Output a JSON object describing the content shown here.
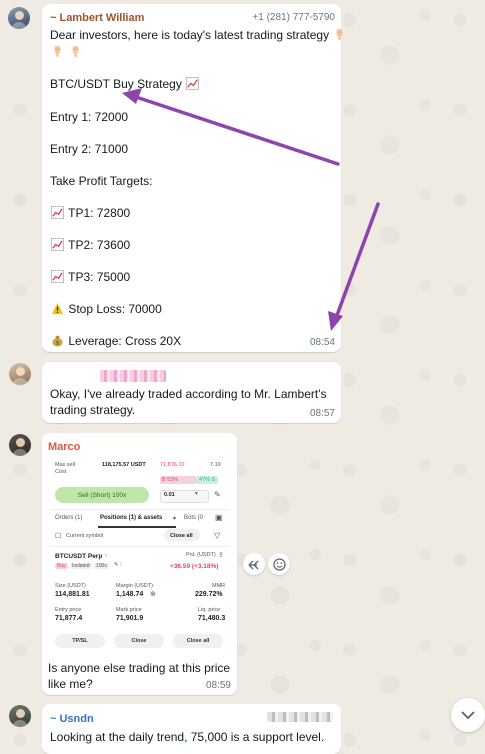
{
  "colors": {
    "chat_background": "#efeae2",
    "bubble": "#ffffff",
    "lambert_name": "#a0522d",
    "marco_name": "#e5533d",
    "usndn_name": "#3772c5",
    "annotation_arrow": "#8e44ad"
  },
  "messages": [
    {
      "sender": "~ Lambert William",
      "phone": "+1 (281) 777-5790",
      "lines": [
        "Dear investors, here is today's latest trading strategy",
        "BTC/USDT Buy Strategy",
        "Entry 1: 72000",
        "Entry 2: 71000",
        "Take Profit Targets:",
        "TP1: 72800",
        "TP2: 73600",
        "TP3: 75000",
        "Stop Loss: 70000",
        "Leverage: Cross 20X"
      ],
      "icons": [
        "pointing-down-hand-icon",
        "chart-increasing-icon",
        "warning-icon",
        "money-bag-icon"
      ],
      "time": "08:54"
    },
    {
      "sender": "",
      "lines": [
        "Okay, I've already traded according to Mr. Lambert's",
        "trading strategy."
      ],
      "time": "08:57"
    },
    {
      "sender": "Marco",
      "screenshot": {
        "max_sell_label": "Max sell",
        "cost_label": "Cost",
        "max_sell_value": "118,175.57 USDT",
        "price": "71,876.10",
        "qty": "7.19",
        "buy_pct": "B 53%",
        "sell_pct": "47% S",
        "sell_button": "Sell (Short) 100x",
        "qty_value": "0.01",
        "tabs": [
          "Orders (1)",
          "Positions (1) & assets",
          "Bots (0"
        ],
        "current_symbol": "Current symbol",
        "close_all_small": "Close all",
        "symbol": "BTCUSDT Perp",
        "side_tags": [
          "Buy",
          "Isolated",
          "100x"
        ],
        "pnl_label": "PnL (USDT)",
        "pnl_value": "+36.59 (+3.18%)",
        "size_label": "Size (USDT)",
        "size_value": "114,881.81",
        "margin_label": "Margin (USDT)",
        "margin_value": "1,148.74",
        "mmr_label": "MMR",
        "mmr_value": "229.72%",
        "entry_label": "Entry price",
        "entry_value": "71,877.4",
        "mark_label": "Mark price",
        "mark_value": "71,901.9",
        "liq_label": "Liq. price",
        "liq_value": "71,480.3",
        "buttons": [
          "TP/SL",
          "Close",
          "Close all"
        ]
      },
      "lines": [
        "Is anyone else trading at this price",
        "like me?"
      ],
      "time": "08:59"
    },
    {
      "sender": "~ Usndn",
      "lines": [
        "Looking at the daily trend, 75,000 is a support level."
      ]
    }
  ]
}
